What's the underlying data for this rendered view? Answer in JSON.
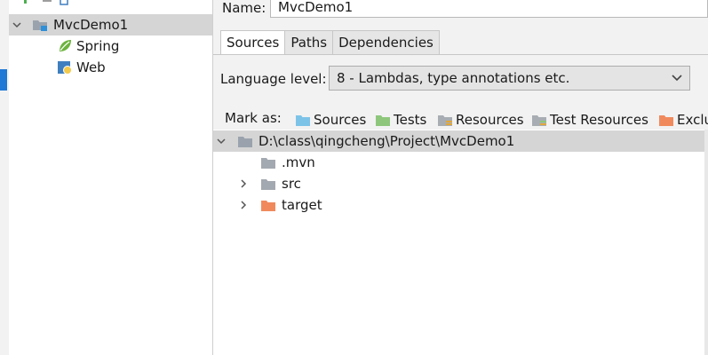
{
  "module_tree": {
    "items": [
      {
        "label": "MvcDemo1",
        "icon": "module-folder-icon",
        "expanded": true,
        "selected": true
      },
      {
        "label": "Spring",
        "icon": "spring-leaf-icon"
      },
      {
        "label": "Web",
        "icon": "web-facet-icon"
      }
    ]
  },
  "module": {
    "name_label": "Name:",
    "name_value": "MvcDemo1"
  },
  "tabs": [
    {
      "label": "Sources",
      "active": true
    },
    {
      "label": "Paths"
    },
    {
      "label": "Dependencies"
    }
  ],
  "language_level": {
    "label": "Language level:",
    "value": "8 - Lambdas, type annotations etc."
  },
  "mark_as": {
    "label": "Mark as:",
    "buttons": [
      {
        "label": "Sources",
        "color": "#7dc3e8"
      },
      {
        "label": "Tests",
        "color": "#8ec77c"
      },
      {
        "label": "Resources",
        "color": "#a8adb3"
      },
      {
        "label": "Test Resources",
        "color": "#a8adb3"
      },
      {
        "label": "Exclu",
        "color": "#f08a5d"
      }
    ]
  },
  "content_root": {
    "path": "D:\\class\\qingcheng\\Project\\MvcDemo1",
    "children": [
      {
        "label": ".mvn",
        "expandable": false,
        "color": "#a3a9b0"
      },
      {
        "label": "src",
        "expandable": true,
        "color": "#a3a9b0"
      },
      {
        "label": "target",
        "expandable": true,
        "color": "#f08a5d"
      }
    ]
  },
  "colors": {
    "accent": "#1e78d6",
    "selection": "#d5d5d5",
    "folder_gray": "#a3a9b0",
    "excluded_orange": "#f08a5d"
  }
}
